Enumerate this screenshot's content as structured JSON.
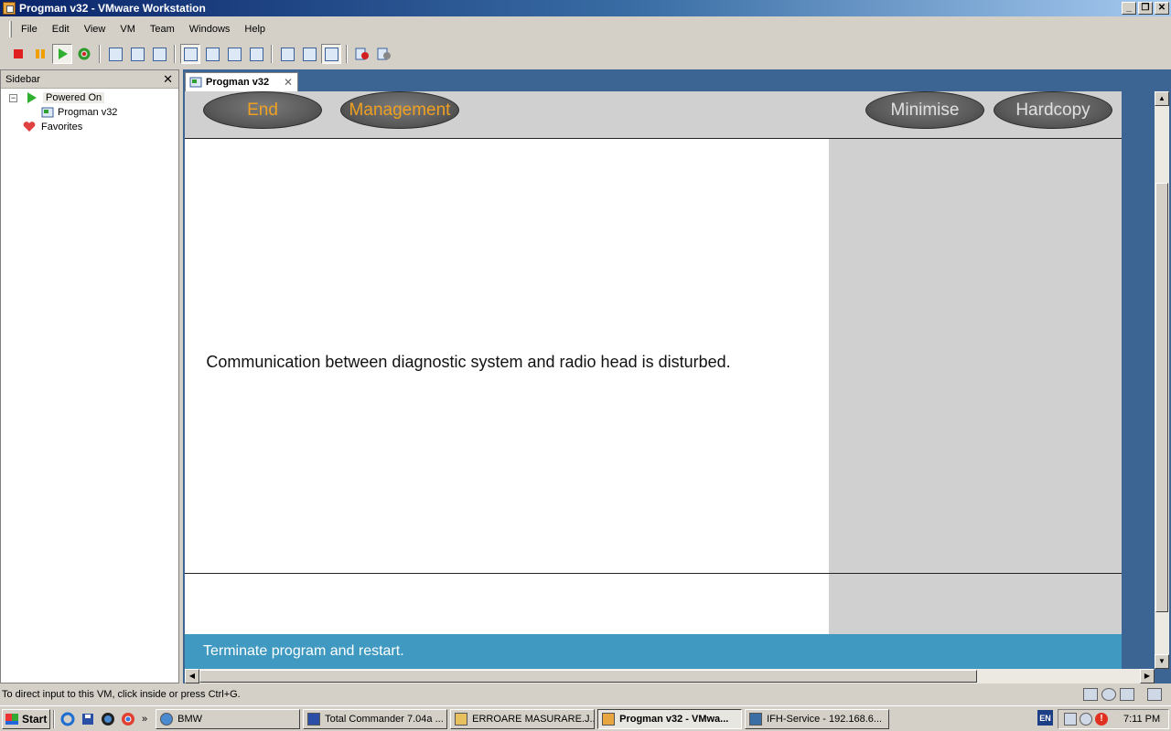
{
  "window": {
    "title": "Progman v32 - VMware Workstation"
  },
  "menubar": [
    "File",
    "Edit",
    "View",
    "VM",
    "Team",
    "Windows",
    "Help"
  ],
  "sidebar": {
    "title": "Sidebar",
    "items": [
      {
        "label": "Powered On"
      },
      {
        "label": "Progman v32"
      },
      {
        "label": "Favorites"
      }
    ]
  },
  "tab": {
    "label": "Progman v32"
  },
  "guest": {
    "buttons": {
      "end": "End",
      "management": "Management",
      "minimise": "Minimise",
      "hardcopy": "Hardcopy"
    },
    "message": "Communication between diagnostic system and radio head is disturbed.",
    "status": "Terminate program and restart."
  },
  "statusbar": {
    "hint": "To direct input to this VM, click inside or press Ctrl+G."
  },
  "taskbar": {
    "start": "Start",
    "tasks": [
      {
        "label": "BMW"
      },
      {
        "label": "Total Commander 7.04a ..."
      },
      {
        "label": "ERROARE MASURARE.J..."
      },
      {
        "label": "Progman v32 - VMwa..."
      },
      {
        "label": "IFH-Service - 192.168.6..."
      }
    ],
    "language": "EN",
    "clock": "7:11 PM"
  },
  "colors": {
    "title_gradient_start": "#0a246a",
    "vm_frame": "#3d6594",
    "guest_status_bar": "#3f99c1",
    "guest_button_orange": "#f0a020"
  }
}
